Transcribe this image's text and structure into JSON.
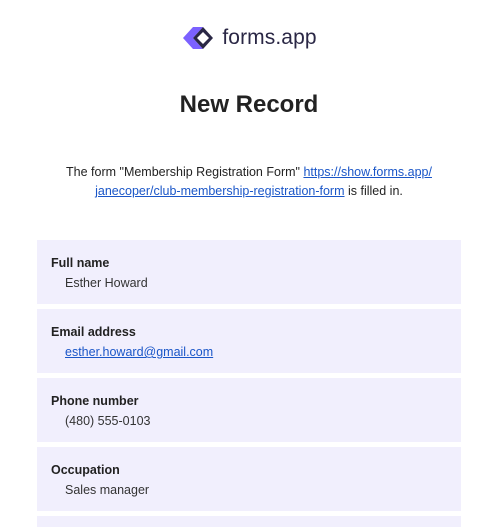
{
  "header": {
    "logo_text": "forms.app",
    "logo_icon": "forms-app-logo-icon"
  },
  "title": "New Record",
  "intro": {
    "prefix": "The form \"Membership Registration Form\" ",
    "link_line1": "https://show.forms.app/",
    "link_line2": "janecoper/club-membership-registration-form",
    "suffix": " is filled in."
  },
  "fields": [
    {
      "label": "Full name",
      "value": "Esther Howard"
    },
    {
      "label": "Email address",
      "value": "esther.howard@gmail.com"
    },
    {
      "label": "Phone number",
      "value": "(480) 555-0103"
    },
    {
      "label": "Occupation",
      "value": "Sales manager"
    }
  ],
  "colors": {
    "brand_purple": "#6c5ce7",
    "brand_dark": "#2a2745",
    "field_background": "#f1effd",
    "link": "#1a56c8"
  }
}
